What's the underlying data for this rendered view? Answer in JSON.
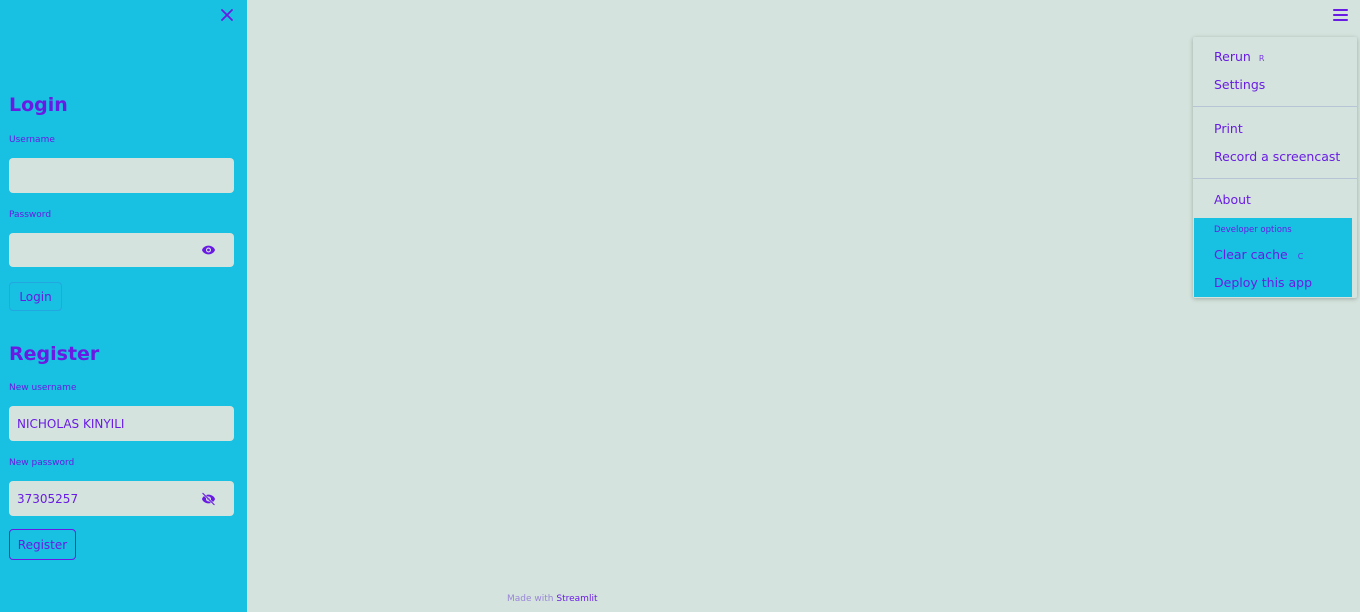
{
  "sidebar": {
    "login": {
      "title": "Login",
      "username_label": "Username",
      "username_value": "",
      "password_label": "Password",
      "password_value": "",
      "button_label": "Login"
    },
    "register": {
      "title": "Register",
      "new_username_label": "New username",
      "new_username_value": "NICHOLAS KINYILI",
      "new_password_label": "New password",
      "new_password_value": "37305257",
      "button_label": "Register"
    }
  },
  "menu": {
    "items": [
      {
        "label": "Rerun",
        "shortcut": "R"
      },
      {
        "label": "Settings",
        "shortcut": ""
      },
      {
        "label": "Print",
        "shortcut": ""
      },
      {
        "label": "Record a screencast",
        "shortcut": ""
      },
      {
        "label": "About",
        "shortcut": ""
      }
    ],
    "developer": {
      "label": "Developer options",
      "items": [
        {
          "label": "Clear cache",
          "shortcut": "C"
        },
        {
          "label": "Deploy this app",
          "shortcut": ""
        }
      ]
    }
  },
  "footer": {
    "prefix": "Made with",
    "link": "Streamlit"
  },
  "icons": {
    "close": "close-icon",
    "eye": "eye-icon",
    "eye_off": "eye-off-icon",
    "menu": "hamburger-menu-icon"
  },
  "colors": {
    "sidebar_bg": "#18c0e1",
    "main_bg": "#d4e3dd",
    "accent": "#6a1be3"
  }
}
